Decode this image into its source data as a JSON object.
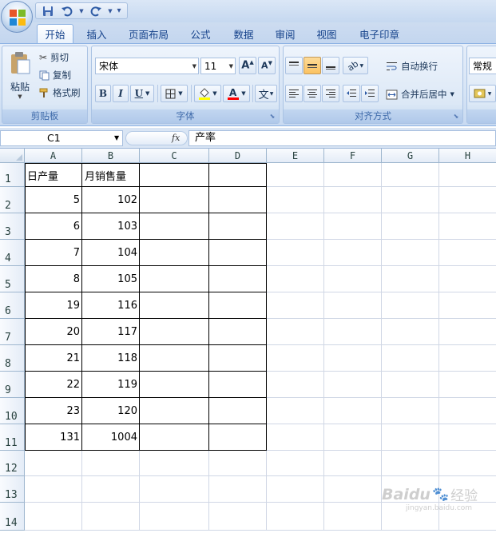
{
  "qat": {
    "save_icon": "save-icon",
    "undo_icon": "undo-icon",
    "redo_icon": "redo-icon",
    "customize": "▾"
  },
  "tabs": [
    "开始",
    "插入",
    "页面布局",
    "公式",
    "数据",
    "审阅",
    "视图",
    "电子印章"
  ],
  "active_tab": "开始",
  "clipboard": {
    "paste_label": "粘贴",
    "cut_label": "剪切",
    "copy_label": "复制",
    "format_painter_label": "格式刷",
    "group_label": "剪贴板"
  },
  "font": {
    "font_name": "宋体",
    "font_size": "11",
    "bold": "B",
    "italic": "I",
    "underline": "U",
    "grow_font": "A",
    "shrink_font": "A",
    "phonetic": "文",
    "group_label": "字体",
    "font_color": "#ff0000",
    "fill_color": "#ffff00"
  },
  "alignment": {
    "wrap_text_label": "自动换行",
    "merge_center_label": "合并后居中",
    "group_label": "对齐方式"
  },
  "number": {
    "format_value": "常规"
  },
  "formula_bar": {
    "name_box": "C1",
    "fx_label": "fx",
    "content": "产率"
  },
  "sheet": {
    "columns": [
      "A",
      "B",
      "C",
      "D",
      "E",
      "F",
      "G",
      "H"
    ],
    "rows": [
      "1",
      "2",
      "3",
      "4",
      "5",
      "6",
      "7",
      "8",
      "9",
      "10",
      "11",
      "12",
      "13",
      "14"
    ],
    "headers": {
      "A1": "日产量",
      "B1": "月销售量"
    },
    "data": [
      {
        "row": "2",
        "a": "5",
        "b": "102"
      },
      {
        "row": "3",
        "a": "6",
        "b": "103"
      },
      {
        "row": "4",
        "a": "7",
        "b": "104"
      },
      {
        "row": "5",
        "a": "8",
        "b": "105"
      },
      {
        "row": "6",
        "a": "19",
        "b": "116"
      },
      {
        "row": "7",
        "a": "20",
        "b": "117"
      },
      {
        "row": "8",
        "a": "21",
        "b": "118"
      },
      {
        "row": "9",
        "a": "22",
        "b": "119"
      },
      {
        "row": "10",
        "a": "23",
        "b": "120"
      },
      {
        "row": "11",
        "a": "131",
        "b": "1004"
      }
    ]
  },
  "watermark": {
    "text": "Baidu",
    "sub": "经验",
    "url": "jingyan.baidu.com"
  }
}
